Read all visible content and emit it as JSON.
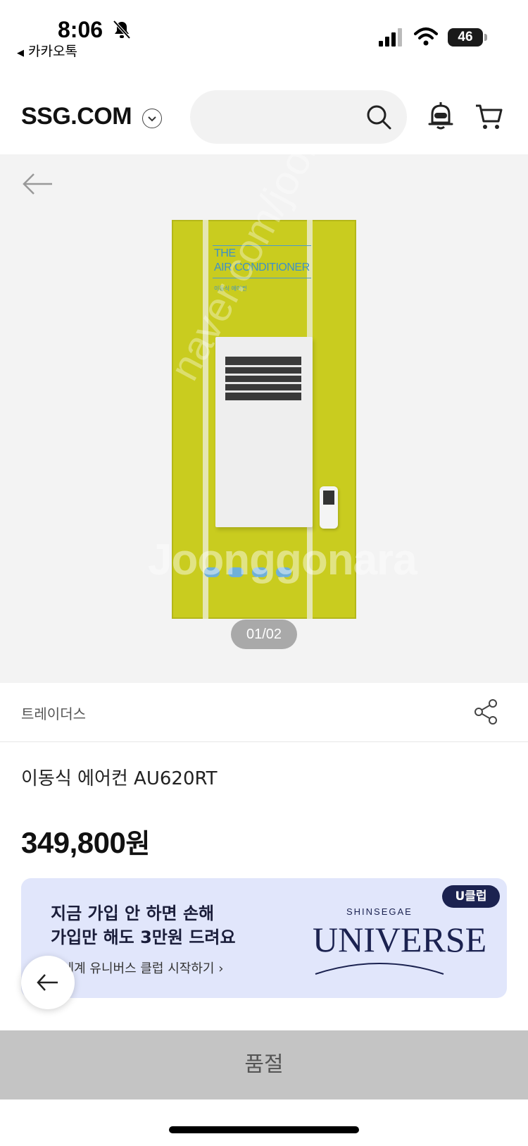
{
  "status_bar": {
    "time": "8:06",
    "back_app": "카카오톡",
    "battery": "46"
  },
  "header": {
    "logo": "SSG.COM",
    "icons": [
      "chevron-down-icon",
      "search-icon",
      "chatbot-icon",
      "cart-icon"
    ]
  },
  "gallery": {
    "counter": "01/02",
    "image_text": {
      "line1": "THE",
      "line2": "AIR CONDITIONER",
      "sub": "이동식 에어컨"
    },
    "watermark": "Joonggonara"
  },
  "seller": {
    "name": "트레이더스"
  },
  "product": {
    "title": "이동식 에어컨 AU620RT",
    "price": "349,800",
    "price_unit": "원"
  },
  "promo": {
    "line1": "지금 가입 안 하면 손해",
    "line2": "가입만 해도 3만원 드려요",
    "link": "신세계 유니버스 클럽 시작하기",
    "badge": "U클럽",
    "brand_top": "SHINSEGAE",
    "brand": "UNIVERSE",
    "accent_color": "#1b2250",
    "background_color": "#e1e6fb"
  },
  "bottom": {
    "soldout_label": "품절"
  }
}
